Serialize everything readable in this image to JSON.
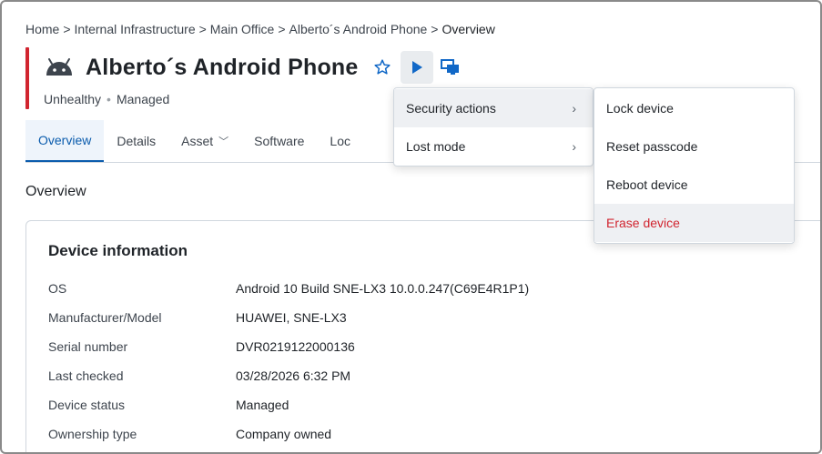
{
  "breadcrumb": {
    "items": [
      "Home",
      "Internal Infrastructure",
      "Main Office",
      "Alberto´s Android Phone"
    ],
    "current": "Overview",
    "separator": ">"
  },
  "device": {
    "title": "Alberto´s Android Phone",
    "health": "Unhealthy",
    "management": "Managed",
    "status_separator": "•"
  },
  "icons": {
    "platform": "android-icon",
    "favorite": "star-outline-icon",
    "actions": "play-icon",
    "remote": "remote-desktop-icon"
  },
  "tabs": [
    {
      "label": "Overview",
      "active": true
    },
    {
      "label": "Details",
      "active": false
    },
    {
      "label": "Asset",
      "active": false,
      "dropdown": true
    },
    {
      "label": "Software",
      "active": false
    },
    {
      "label": "Loc",
      "active": false
    }
  ],
  "section_title": "Overview",
  "device_info": {
    "title": "Device information",
    "rows": [
      {
        "label": "OS",
        "value": "Android 10 Build SNE-LX3 10.0.0.247(C69E4R1P1)"
      },
      {
        "label": "Manufacturer/Model",
        "value": "HUAWEI, SNE-LX3"
      },
      {
        "label": "Serial number",
        "value": "DVR0219122000136"
      },
      {
        "label": "Last checked",
        "value": "03/28/2026 6:32 PM"
      },
      {
        "label": "Device status",
        "value": "Managed"
      },
      {
        "label": "Ownership type",
        "value": "Company owned"
      }
    ]
  },
  "actions_menu": {
    "items": [
      {
        "label": "Security actions",
        "arrow": "›",
        "highlighted": true
      },
      {
        "label": "Lost mode",
        "arrow": "›",
        "highlighted": false
      }
    ]
  },
  "security_submenu": {
    "items": [
      {
        "label": "Lock device",
        "danger": false,
        "highlighted": false
      },
      {
        "label": "Reset passcode",
        "danger": false,
        "highlighted": false
      },
      {
        "label": "Reboot device",
        "danger": false,
        "highlighted": false
      },
      {
        "label": "Erase device",
        "danger": true,
        "highlighted": true
      }
    ]
  },
  "colors": {
    "accent_blue": "#0b5cad",
    "danger_red": "#d1242f",
    "status_bar": "#d1242f",
    "icon_blue": "#1168c7"
  }
}
